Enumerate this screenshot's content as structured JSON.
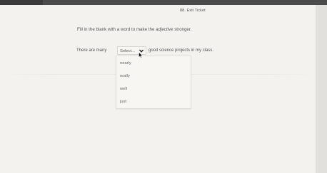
{
  "question": {
    "number_label": "88. Exit Ticket",
    "prompt_before": "Fill in the blank with a word to make the ",
    "prompt_emphasis": "adjective",
    "prompt_after": " stronger."
  },
  "sentence": {
    "before": "There are many",
    "after": "good science projects in my class."
  },
  "select": {
    "current_value": "Select..."
  },
  "dropdown": {
    "options": [
      "nearly",
      "really",
      "well",
      "just"
    ]
  },
  "icons": {
    "chevron": "chevron-down-icon",
    "cursor": "mouse-pointer-icon"
  }
}
